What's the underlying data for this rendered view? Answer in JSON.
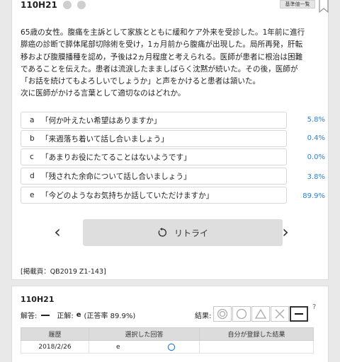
{
  "question": {
    "id": "110H21",
    "badge": "基準値一覧",
    "lines": [
      "65歳の女性。腹痛を主訴として家族とともに緩和ケア外来を受診した。1年前に進行",
      "膵癌の診断で膵体尾部切除術を受け，1ヵ月前から腹痛が出現した。局所再発，肝転",
      "移および腹膜播種を認め，予後は2ヵ月程度と考えられる。医師が患者に根治は困難",
      "であることを伝えた。患者は流涙したまましばらく沈黙が続いた。その後，医師が",
      "「お話を続けてもよろしいでしょうか」と声をかけると患者は頷いた。",
      "次に医師がかける言葉として適切なのはどれか。"
    ]
  },
  "options": [
    {
      "letter": "a",
      "text": "「何か叶えたい希望はありますか」",
      "pct": "5.8%"
    },
    {
      "letter": "b",
      "text": "「来週落ち着いて話し合いましょう」",
      "pct": "0.4%"
    },
    {
      "letter": "c",
      "text": "「あまりお役にたてることはないようです」",
      "pct": "0.0%"
    },
    {
      "letter": "d",
      "text": "「残された余命について話し合いましょう」",
      "pct": "3.8%"
    },
    {
      "letter": "e",
      "text": "「今どのようなお気持ちか話していただけますか」",
      "pct": "89.9%"
    }
  ],
  "nav": {
    "prev": "‹",
    "next": "›",
    "retry_label": "リトライ"
  },
  "source": "[掲載頁：QB2019 Z1-143]",
  "answer_panel": {
    "id": "110H21",
    "answer_label": "解答:",
    "correct_label": "正解:",
    "correct_value": "e",
    "correct_rate": "(正答率 89.9%)",
    "result_label": "結果:",
    "help": "?",
    "history_headers": [
      "履歴",
      "選択した回答",
      "自分が登録した結果"
    ],
    "history_rows": [
      {
        "date": "2018/2/26",
        "answer": "e"
      }
    ]
  },
  "colors": {
    "percent": "#2f7fd0",
    "result_circle": "#2f7fd0"
  }
}
